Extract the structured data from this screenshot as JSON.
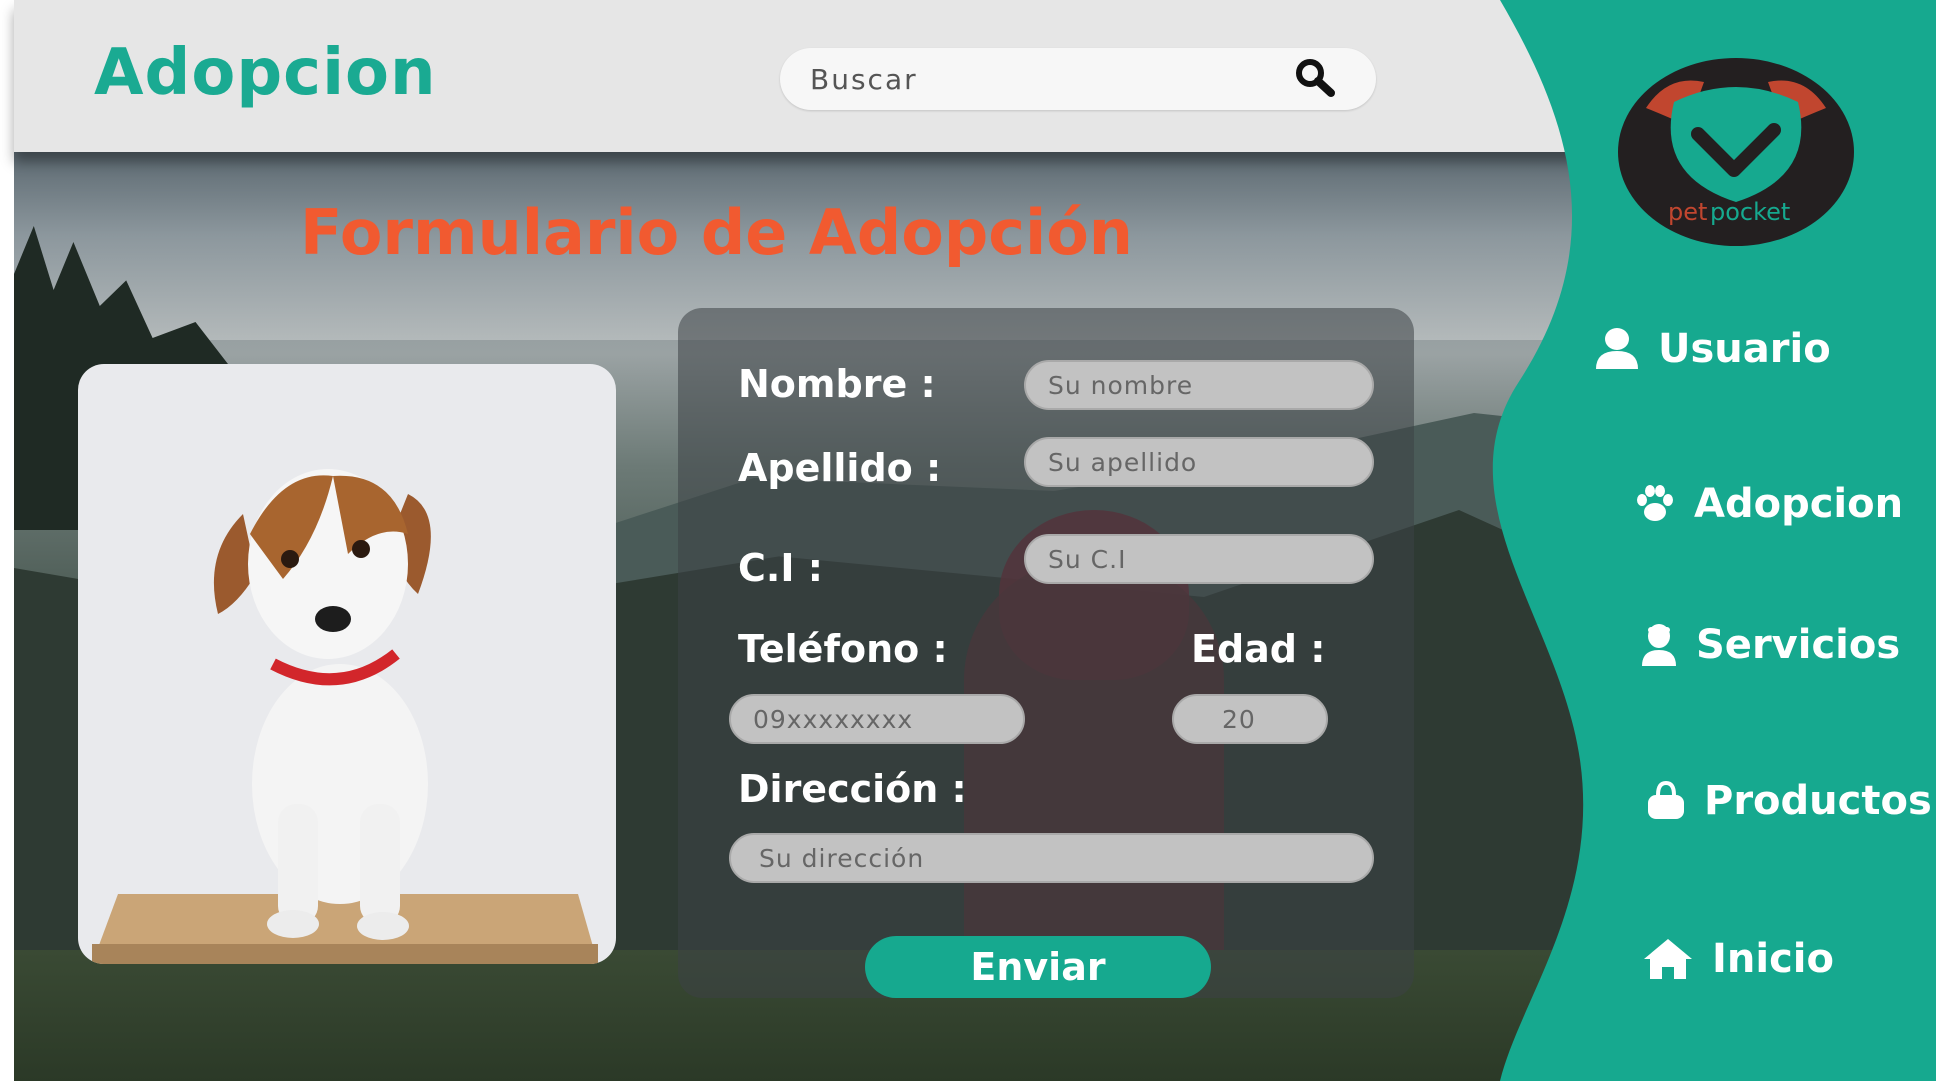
{
  "header": {
    "app_title": "Adopcion",
    "search_placeholder": "Buscar"
  },
  "brand": {
    "logo_text_pet": "pet",
    "logo_text_pocket": "pocket"
  },
  "page": {
    "form_title": "Formulario de Adopción"
  },
  "form": {
    "fields": [
      {
        "label": "Nombre :",
        "placeholder": "Su nombre"
      },
      {
        "label": "Apellido :",
        "placeholder": "Su apellido"
      },
      {
        "label": "C.I :",
        "placeholder": "Su C.I"
      },
      {
        "label": "Teléfono :",
        "placeholder": "09xxxxxxxx"
      },
      {
        "label": "Edad :",
        "placeholder": "20"
      },
      {
        "label": "Dirección :",
        "placeholder": "Su dirección"
      }
    ],
    "submit_label": "Enviar"
  },
  "sidebar": {
    "items": [
      {
        "label": "Usuario",
        "icon": "user-icon"
      },
      {
        "label": "Adopcion",
        "icon": "paw-icon"
      },
      {
        "label": "Servicios",
        "icon": "service-person-icon"
      },
      {
        "label": "Productos",
        "icon": "shopping-bag-icon"
      },
      {
        "label": "Inicio",
        "icon": "home-icon"
      }
    ]
  },
  "colors": {
    "accent_teal": "#16a98f",
    "title_teal": "#1aaa92",
    "title_orange": "#f15a30",
    "logo_dark": "#231f20",
    "logo_brown": "#c1462f"
  }
}
